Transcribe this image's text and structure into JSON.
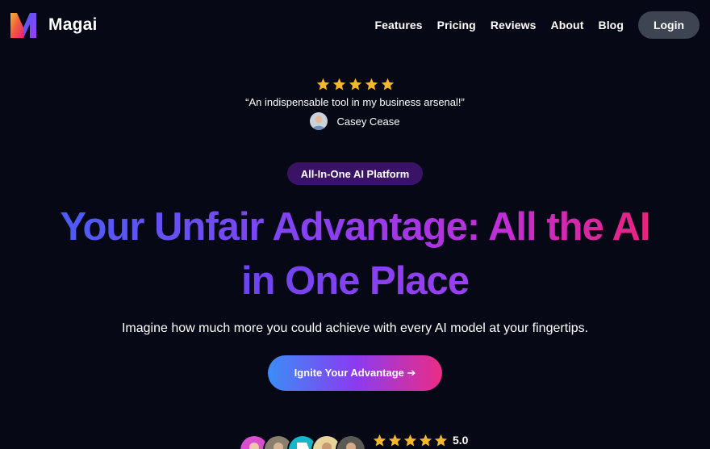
{
  "header": {
    "brand": "Magai",
    "nav": [
      {
        "label": "Features"
      },
      {
        "label": "Pricing"
      },
      {
        "label": "Reviews"
      },
      {
        "label": "About"
      },
      {
        "label": "Blog"
      }
    ],
    "login_label": "Login"
  },
  "testimonial": {
    "stars": 5,
    "quote": "“An indispensable tool in my business arsenal!”",
    "author": "Casey Cease"
  },
  "hero": {
    "badge": "All-In-One AI Platform",
    "headline_line1": "Your Unfair Advantage: All the AI",
    "headline_line2": "in One Place",
    "subtitle": "Imagine how much more you could achieve with every AI model at your fingertips.",
    "cta_label": "Ignite Your Advantage ➔"
  },
  "social_proof": {
    "stars": 5,
    "rating": "5.0"
  },
  "colors": {
    "background": "#070816",
    "star": "#f6b82a",
    "badge_bg": "#3a1367",
    "login_bg": "#3d4452"
  },
  "icons": {
    "logo": "magai-logo-icon",
    "star": "star-icon"
  }
}
